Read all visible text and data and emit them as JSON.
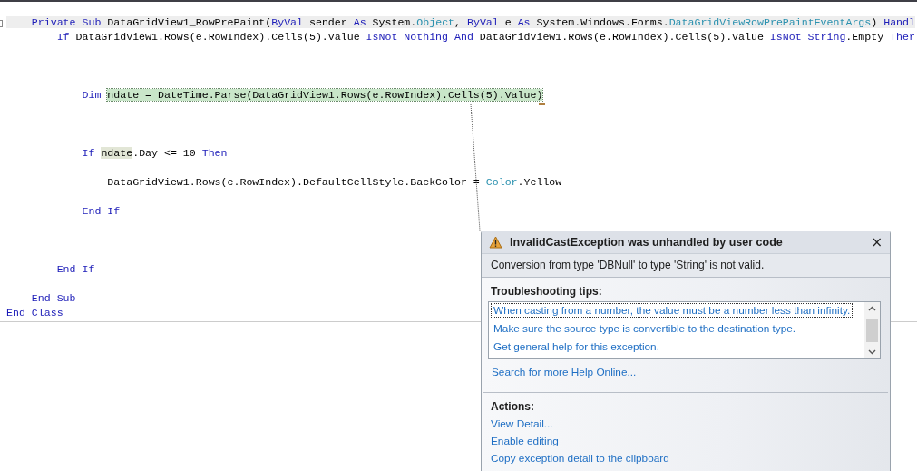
{
  "code_lines": [
    {
      "kind": "code",
      "current": true,
      "tokens": [
        {
          "text": "    Private Sub",
          "kind": "keyword"
        },
        {
          "text": " DataGridView1_RowPrePaint(",
          "kind": "plain"
        },
        {
          "text": "ByVal",
          "kind": "keyword"
        },
        {
          "text": " sender ",
          "kind": "plain"
        },
        {
          "text": "As",
          "kind": "keyword"
        },
        {
          "text": " System.",
          "kind": "plain"
        },
        {
          "text": "Object",
          "kind": "type"
        },
        {
          "text": ", ",
          "kind": "plain"
        },
        {
          "text": "ByVal",
          "kind": "keyword"
        },
        {
          "text": " e ",
          "kind": "plain"
        },
        {
          "text": "As",
          "kind": "keyword"
        },
        {
          "text": " System.Windows.Forms.",
          "kind": "plain"
        },
        {
          "text": "DataGridViewRowPrePaintEventArgs",
          "kind": "type"
        },
        {
          "text": ") ",
          "kind": "plain"
        },
        {
          "text": "Handl",
          "kind": "keyword"
        }
      ]
    },
    {
      "kind": "code",
      "current": false,
      "tokens": [
        {
          "text": "        If",
          "kind": "keyword"
        },
        {
          "text": " DataGridView1.Rows(e.RowIndex).Cells(5).Value ",
          "kind": "plain"
        },
        {
          "text": "IsNot Nothing And",
          "kind": "keyword"
        },
        {
          "text": " DataGridView1.Rows(e.RowIndex).Cells(5).Value ",
          "kind": "plain"
        },
        {
          "text": "IsNot String",
          "kind": "keyword"
        },
        {
          "text": ".Empty ",
          "kind": "plain"
        },
        {
          "text": "Ther",
          "kind": "keyword"
        }
      ]
    },
    {
      "kind": "blank"
    },
    {
      "kind": "blank"
    },
    {
      "kind": "blank"
    },
    {
      "kind": "code",
      "current": false,
      "tokens": [
        {
          "text": "            Dim ",
          "kind": "keyword"
        },
        {
          "text": "ndate = DateTime.Parse(DataGridView1.Rows(e.RowIndex).Cells(5).Value)",
          "kind": "error"
        }
      ]
    },
    {
      "kind": "blank"
    },
    {
      "kind": "blank"
    },
    {
      "kind": "blank"
    },
    {
      "kind": "code",
      "current": false,
      "tokens": [
        {
          "text": "            If ",
          "kind": "keyword"
        },
        {
          "text": "ndate",
          "kind": "reference"
        },
        {
          "text": ".Day <= 10 ",
          "kind": "plain"
        },
        {
          "text": "Then",
          "kind": "keyword"
        }
      ]
    },
    {
      "kind": "blank"
    },
    {
      "kind": "code",
      "current": false,
      "tokens": [
        {
          "text": "                DataGridView1.Rows(e.RowIndex).DefaultCellStyle.BackColor = ",
          "kind": "plain"
        },
        {
          "text": "Color",
          "kind": "type"
        },
        {
          "text": ".Yellow",
          "kind": "plain"
        }
      ]
    },
    {
      "kind": "blank"
    },
    {
      "kind": "code",
      "current": false,
      "tokens": [
        {
          "text": "            End If",
          "kind": "keyword"
        }
      ]
    },
    {
      "kind": "blank"
    },
    {
      "kind": "blank"
    },
    {
      "kind": "blank"
    },
    {
      "kind": "code",
      "current": false,
      "tokens": [
        {
          "text": "        End If",
          "kind": "keyword"
        }
      ]
    },
    {
      "kind": "blank"
    },
    {
      "kind": "code",
      "current": false,
      "tokens": [
        {
          "text": "    End Sub",
          "kind": "keyword"
        }
      ]
    },
    {
      "kind": "code",
      "current": false,
      "tokens": [
        {
          "text": "End Class",
          "kind": "keyword"
        }
      ]
    }
  ],
  "exception": {
    "title": "InvalidCastException was unhandled by user code",
    "close": "×",
    "message": "Conversion from type 'DBNull' to type 'String' is not valid.",
    "tips_heading": "Troubleshooting tips:",
    "tips": [
      {
        "text": "When casting from a number, the value must be a number less than infinity.",
        "focused": true
      },
      {
        "text": "Make sure the source type is convertible to the destination type.",
        "focused": false
      },
      {
        "text": "Get general help for this exception.",
        "focused": false
      }
    ],
    "search_link": "Search for more Help Online...",
    "actions_heading": "Actions:",
    "actions": [
      "View Detail...",
      "Enable editing",
      "Copy exception detail to the clipboard"
    ]
  }
}
